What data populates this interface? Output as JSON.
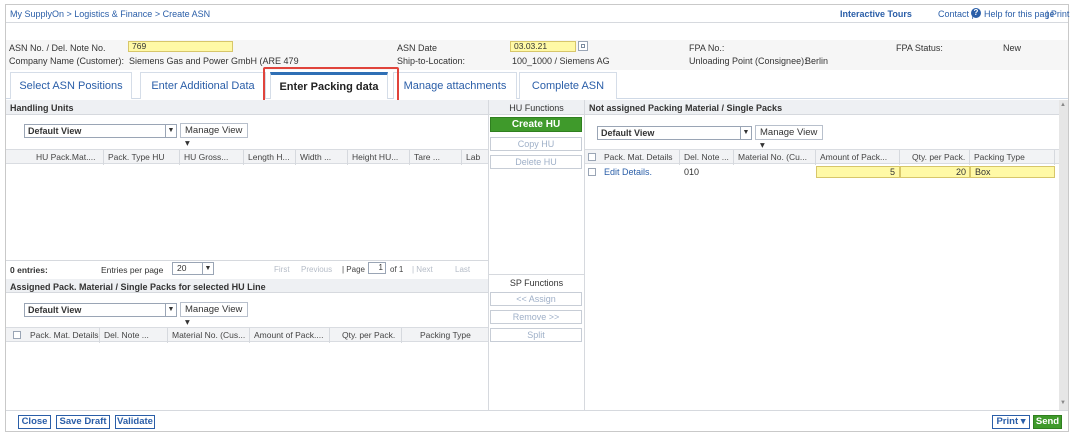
{
  "breadcrumb": "My SupplyOn > Logistics & Finance > Create ASN",
  "toplinks": {
    "tours": "Interactive Tours",
    "contact": "Contact |",
    "help": "Help for this page",
    "print": "| Print"
  },
  "header": {
    "asn_no_label": "ASN No. / Del. Note No.",
    "asn_no_value": "769",
    "asn_date_label": "ASN Date",
    "asn_date_value": "03.03.21",
    "fpa_no_label": "FPA No.:",
    "fpa_status_label": "FPA Status:",
    "fpa_status_value": "New",
    "company_label": "Company Name (Customer):",
    "company_value": "Siemens Gas and Power GmbH (ARE 479",
    "ship_label": "Ship-to-Location:",
    "ship_value": "100_1000 / Siemens AG",
    "unloading_label": "Unloading Point (Consignee):",
    "unloading_value": "Berlin"
  },
  "tabs": [
    "Select ASN Positions",
    "Enter Additional Data",
    "Enter Packing data",
    "Manage attachments",
    "Complete ASN"
  ],
  "hu": {
    "title": "Handling Units",
    "view": "Default View",
    "manage_view": "Manage View",
    "columns": [
      "HU Pack.Mat....",
      "Pack. Type HU",
      "HU Gross...",
      "Length H...",
      "Width ...",
      "Height HU...",
      "Tare ...",
      "Lab"
    ],
    "entries": "0 entries:",
    "entries_per_page_label": "Entries per page",
    "entries_per_page": "20",
    "first": "First",
    "previous": "Previous",
    "page_label": "| Page",
    "page": "1",
    "of": "of 1",
    "next": "| Next",
    "last": "Last"
  },
  "assigned": {
    "title": "Assigned Pack. Material / Single Packs for selected HU Line",
    "view": "Default View",
    "manage_view": "Manage View",
    "columns": [
      "Pack. Mat. Details",
      "Del. Note ...",
      "Material No. (Cus...",
      "Amount of Pack....",
      "Qty. per Pack.",
      "Packing Type"
    ]
  },
  "hu_functions": {
    "title": "HU Functions",
    "create": "Create HU",
    "copy": "Copy HU",
    "delete": "Delete HU"
  },
  "sp_functions": {
    "title": "SP Functions",
    "assign": "<< Assign",
    "remove": "Remove >>",
    "split": "Split"
  },
  "not_assigned": {
    "title": "Not assigned Packing Material / Single Packs",
    "view": "Default View",
    "manage_view": "Manage View",
    "columns": [
      "Pack. Mat. Details",
      "Del. Note ...",
      "Material No. (Cu...",
      "Amount of Pack...",
      "Qty. per Pack.",
      "Packing Type"
    ],
    "row": {
      "details": "Edit Details.",
      "del_note": "010",
      "material": "",
      "amount": "5",
      "qty": "20",
      "type": "Box"
    }
  },
  "footer": {
    "close": "Close",
    "save_draft": "Save Draft",
    "validate": "Validate",
    "print": "Print",
    "send": "Send"
  }
}
